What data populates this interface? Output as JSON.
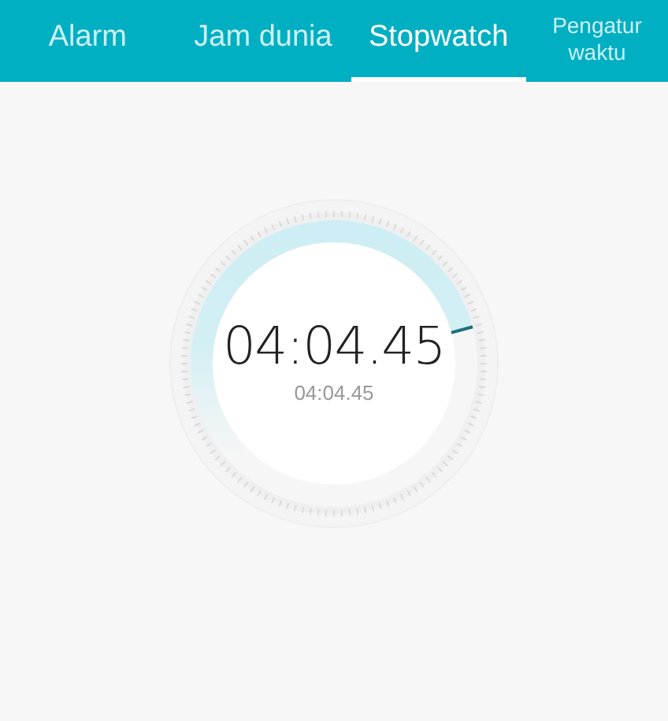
{
  "tabs": [
    {
      "label": "Alarm",
      "selected": false
    },
    {
      "label": "Jam dunia",
      "selected": false
    },
    {
      "label": "Stopwatch",
      "selected": true
    },
    {
      "label": "Pengatur waktu",
      "selected": false
    }
  ],
  "stopwatch": {
    "time": "04:04.45",
    "lap_time": "04:04.45"
  }
}
